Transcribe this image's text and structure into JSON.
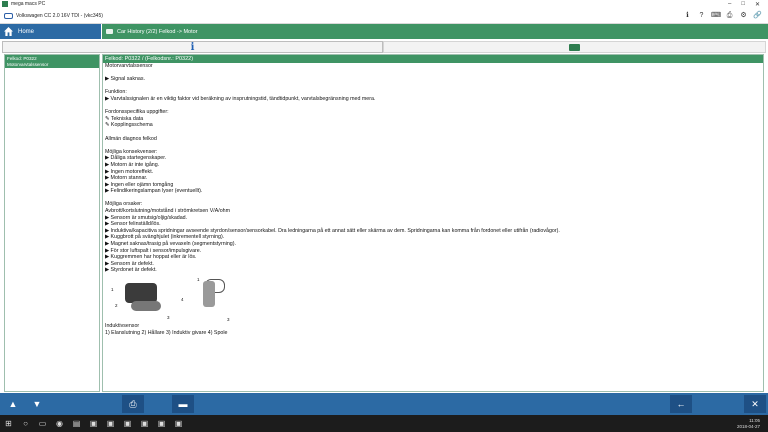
{
  "window": {
    "title": "mega macs PC"
  },
  "vehicle": {
    "label": "Volkswagen CC 2.0 16V TDI - (vkc345)"
  },
  "nav": {
    "home_label": "Home",
    "breadcrumb": "Car History (2/2) Felkod -> Motor"
  },
  "left_panel": {
    "item_code": "Felkod: P0322",
    "item_desc": "Motorvarvtalssensor"
  },
  "fault": {
    "header": "Felkod: P0322 / (Felkodsnr.: P0322)",
    "lines": [
      "Motorvarvtalssensor",
      "",
      "▶ Signal saknas.",
      "",
      "Funktion:",
      "▶ Varvtalssignalen är en viktig faktor vid beräkning av insprutningstid, tändtidpunkt, varvtalsbegränsning med mera.",
      "",
      "Fordonsspecifika uppgifter:",
      "✎ Tekniska data",
      "✎ Kopplingsschema",
      "",
      "Allmän diagnos felkod",
      "",
      "Möjliga konsekvenser:",
      "▶ Dåliga startegenskaper.",
      "▶ Motorn är inte igång.",
      "▶ Ingen motoreffekt.",
      "▶ Motorn stannar.",
      "▶ Ingen eller ojämn tomgång",
      "▶ Felindikeringslampan lyser (eventuellt).",
      "",
      "Möjliga orsaker:",
      "Avbrott/kortslutning/motstånd i strömkretsen V/A/ohm",
      "▶ Sensorn är smutsig/oljig/skadad.",
      "▶ Sensor felinställd/lös.",
      "▶ Induktiva/kapacitiva spridningar avseende styrdon/sensor/sensorkabel. Dra ledningarna på ett annat sätt eller skärma av dem. Spridningarna kan komma från fordonet eller utifrån (radiovågor).",
      "▶ Kuggbrott på svänghjulet (inkrementell styrning).",
      "▶ Magnet saknas/trasig på vevaxeln (segmentstyrning).",
      "▶ För stor luftspalt i sensor/impulsgivare.",
      "▶ Kuggremmen har hoppat eller är lös.",
      "▶ Sensorn är defekt.",
      "▶ Styrdonet är defekt."
    ],
    "figure_labels": [
      "1",
      "2",
      "3",
      "4",
      "1",
      "3"
    ],
    "caption_title": "Induktivsensor",
    "caption_parts": "1) Elanslutning 2) Hållare 3) Induktiv givare 4) Spole"
  },
  "taskbar": {
    "time": "11:05",
    "date": "2018-04-27"
  },
  "colors": {
    "green": "#3f9464",
    "blue": "#2c6aa4",
    "taskbar": "#1c1c1c"
  },
  "icons": {
    "toolbar": [
      "info-icon",
      "help-icon",
      "keyboard-icon",
      "print-icon",
      "settings-icon",
      "link-icon"
    ],
    "bottom": [
      "arrow-up-icon",
      "arrow-down-icon",
      "printer-icon",
      "folder-icon",
      "back-arrow-icon",
      "close-icon"
    ]
  }
}
